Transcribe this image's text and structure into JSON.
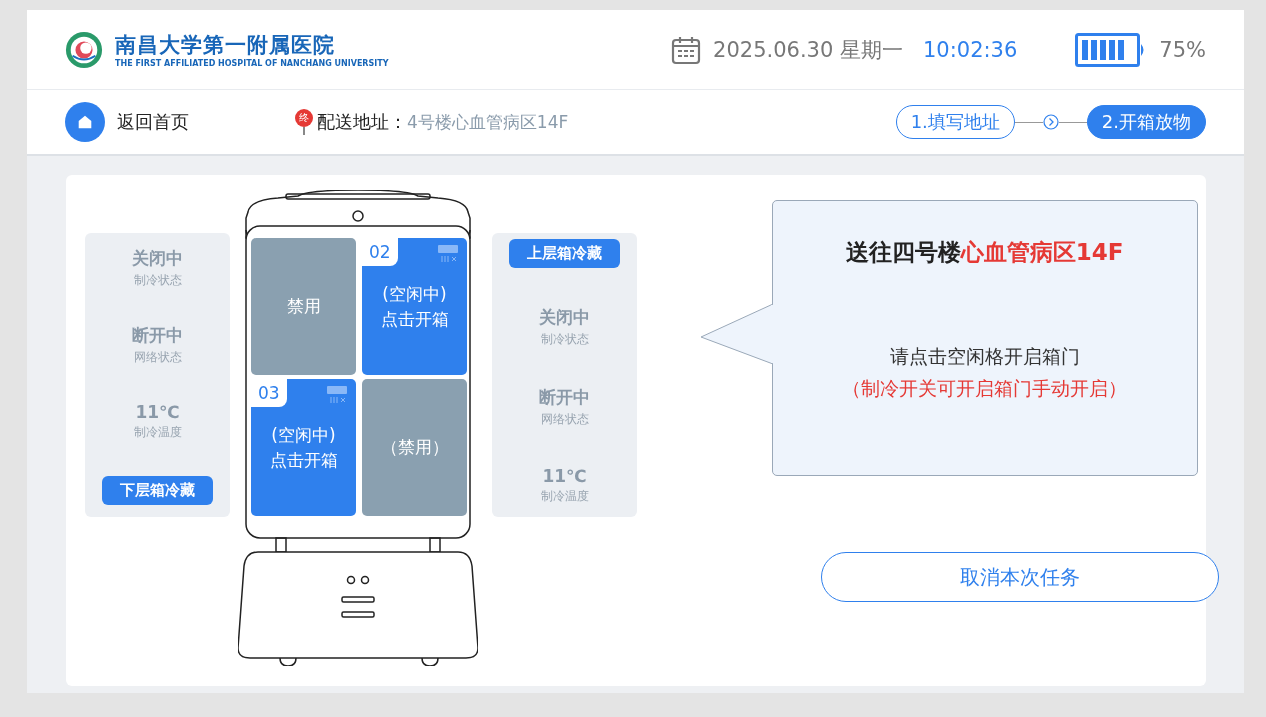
{
  "header": {
    "hospital_name": "南昌大学第一附属医院",
    "hospital_name_en": "THE FIRST AFFILIATED HOSPITAL OF NANCHANG UNIVERSITY",
    "date": "2025.06.30 星期一",
    "time": "10:02:36",
    "battery": "75%"
  },
  "nav": {
    "home": "返回首页",
    "address_label": "配送地址：",
    "address": "4号楼心血管病区14F",
    "pin_badge": "终",
    "steps": [
      {
        "label": "1.填写地址",
        "selected": false
      },
      {
        "label": "2.开箱放物",
        "selected": true
      }
    ]
  },
  "lower_panel": {
    "stats": [
      {
        "value": "关闭中",
        "label": "制冷状态"
      },
      {
        "value": "断开中",
        "label": "网络状态"
      },
      {
        "value": "11℃",
        "label": "制冷温度"
      }
    ],
    "button": "下层箱冷藏"
  },
  "cells": [
    {
      "kind": "disabled",
      "text": "禁用"
    },
    {
      "kind": "idle",
      "number": "02",
      "status": "(空闲中)",
      "action": "点击开箱"
    },
    {
      "kind": "idle",
      "number": "03",
      "status": "(空闲中)",
      "action": "点击开箱"
    },
    {
      "kind": "disabled",
      "text": "（禁用）"
    }
  ],
  "upper_panel": {
    "button": "上层箱冷藏",
    "stats": [
      {
        "value": "关闭中",
        "label": "制冷状态"
      },
      {
        "value": "断开中",
        "label": "网络状态"
      },
      {
        "value": "11℃",
        "label": "制冷温度"
      }
    ]
  },
  "message": {
    "title": "送往四号楼",
    "title_highlight": "心血管病区14F",
    "instruction": "请点击空闲格开启箱门",
    "note": "（制冷开关可开启箱门手动开启）"
  },
  "cancel_button": "取消本次任务"
}
